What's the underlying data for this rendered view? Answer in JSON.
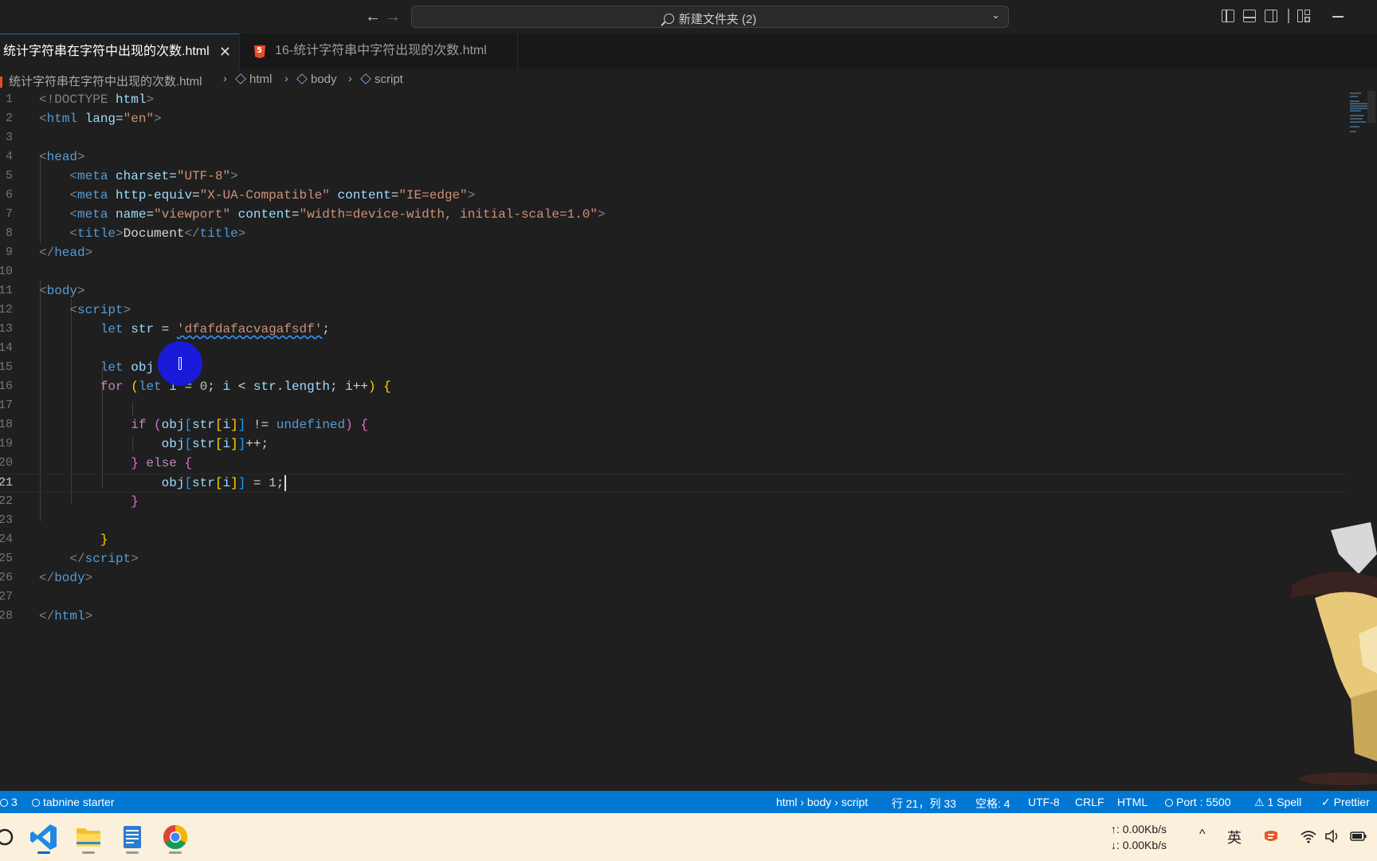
{
  "titlebar": {
    "search_text": "新建文件夹 (2)"
  },
  "tabs": [
    {
      "label": "统计字符串在字符中出现的次数.html",
      "close": "✕",
      "active": true
    },
    {
      "label": "16-统计字符串中字符出现的次数.html",
      "icon_text": "5",
      "active": false
    }
  ],
  "breadcrumbs": [
    "统计字符串在字符中出现的次数.html",
    "html",
    "body",
    "script"
  ],
  "editor": {
    "line_numbers": [
      "1",
      "2",
      "3",
      "4",
      "5",
      "6",
      "7",
      "8",
      "9",
      "10",
      "11",
      "12",
      "13",
      "14",
      "15",
      "16",
      "17",
      "18",
      "19",
      "20",
      "21",
      "22",
      "23",
      "24",
      "25",
      "26",
      "27",
      "28"
    ],
    "current_line": "21",
    "code": {
      "l1": [
        "<!DOCTYPE",
        "html",
        ">"
      ],
      "l2": [
        "<",
        "html",
        "lang",
        "=",
        "\"en\"",
        ">"
      ],
      "l4": [
        "<",
        "head",
        ">"
      ],
      "l5": [
        "<",
        "meta",
        "charset",
        "=",
        "\"UTF-8\"",
        ">"
      ],
      "l6": [
        "<",
        "meta",
        "http-equiv",
        "=",
        "\"X-UA-Compatible\"",
        "content",
        "=",
        "\"IE=edge\"",
        ">"
      ],
      "l7": [
        "<",
        "meta",
        "name",
        "=",
        "\"viewport\"",
        "content",
        "=",
        "\"width=device-width, initial-scale=1.0\"",
        ">"
      ],
      "l8": [
        "<",
        "title",
        ">",
        "Document",
        "</",
        "title",
        ">"
      ],
      "l9": [
        "</",
        "head",
        ">"
      ],
      "l11": [
        "<",
        "body",
        ">"
      ],
      "l12": [
        "<",
        "script",
        ">"
      ],
      "l13": [
        "let",
        "str",
        " = ",
        "'dfafdafacvagafsdf'",
        ";"
      ],
      "l15": [
        "let",
        "obj",
        " = ",
        "{",
        "}",
        ";"
      ],
      "l16": [
        "for",
        "(",
        "let",
        "i",
        " = ",
        "0",
        "; ",
        "i",
        " < ",
        "str",
        ".",
        "length",
        "; ",
        "i",
        "++",
        ")",
        " {"
      ],
      "l18": [
        "if",
        "(",
        "obj",
        "[",
        "str",
        "[",
        "i",
        "]",
        "]",
        " != ",
        "undefined",
        ")",
        " {"
      ],
      "l19": [
        "obj",
        "[",
        "str",
        "[",
        "i",
        "]",
        "]",
        "++;"
      ],
      "l20": [
        "}",
        " else ",
        "{"
      ],
      "l21": [
        "obj",
        "[",
        "str",
        "[",
        "i",
        "]",
        "]",
        " = ",
        "1",
        ";"
      ],
      "l22": [
        "}"
      ],
      "l24": [
        "}"
      ],
      "l25": [
        "</",
        "script",
        ">"
      ],
      "l26": [
        "</",
        "body",
        ">"
      ],
      "l28": [
        "</",
        "html",
        ">"
      ]
    }
  },
  "statusbar": {
    "problems": "3",
    "tabnine": "tabnine starter",
    "breadcrumb": "html › body › script",
    "position": "行 21，列 33",
    "spaces": "空格: 4",
    "encoding": "UTF-8",
    "eol": "CRLF",
    "language": "HTML",
    "port": "Port : 5500",
    "spell": "1 Spell",
    "prettier": "Prettier"
  },
  "taskbar": {
    "apps": [
      "search-icon",
      "vscode-icon",
      "file-explorer-icon",
      "notepad-icon",
      "chrome-icon"
    ],
    "upload_speed": "↑: 0.00Kb/s",
    "download_speed": "↓: 0.00Kb/s",
    "ime": "英"
  },
  "colors": {
    "accent": "#0078d4",
    "editor_bg": "#1f1f1f",
    "click_marker": "#1a1adb"
  }
}
